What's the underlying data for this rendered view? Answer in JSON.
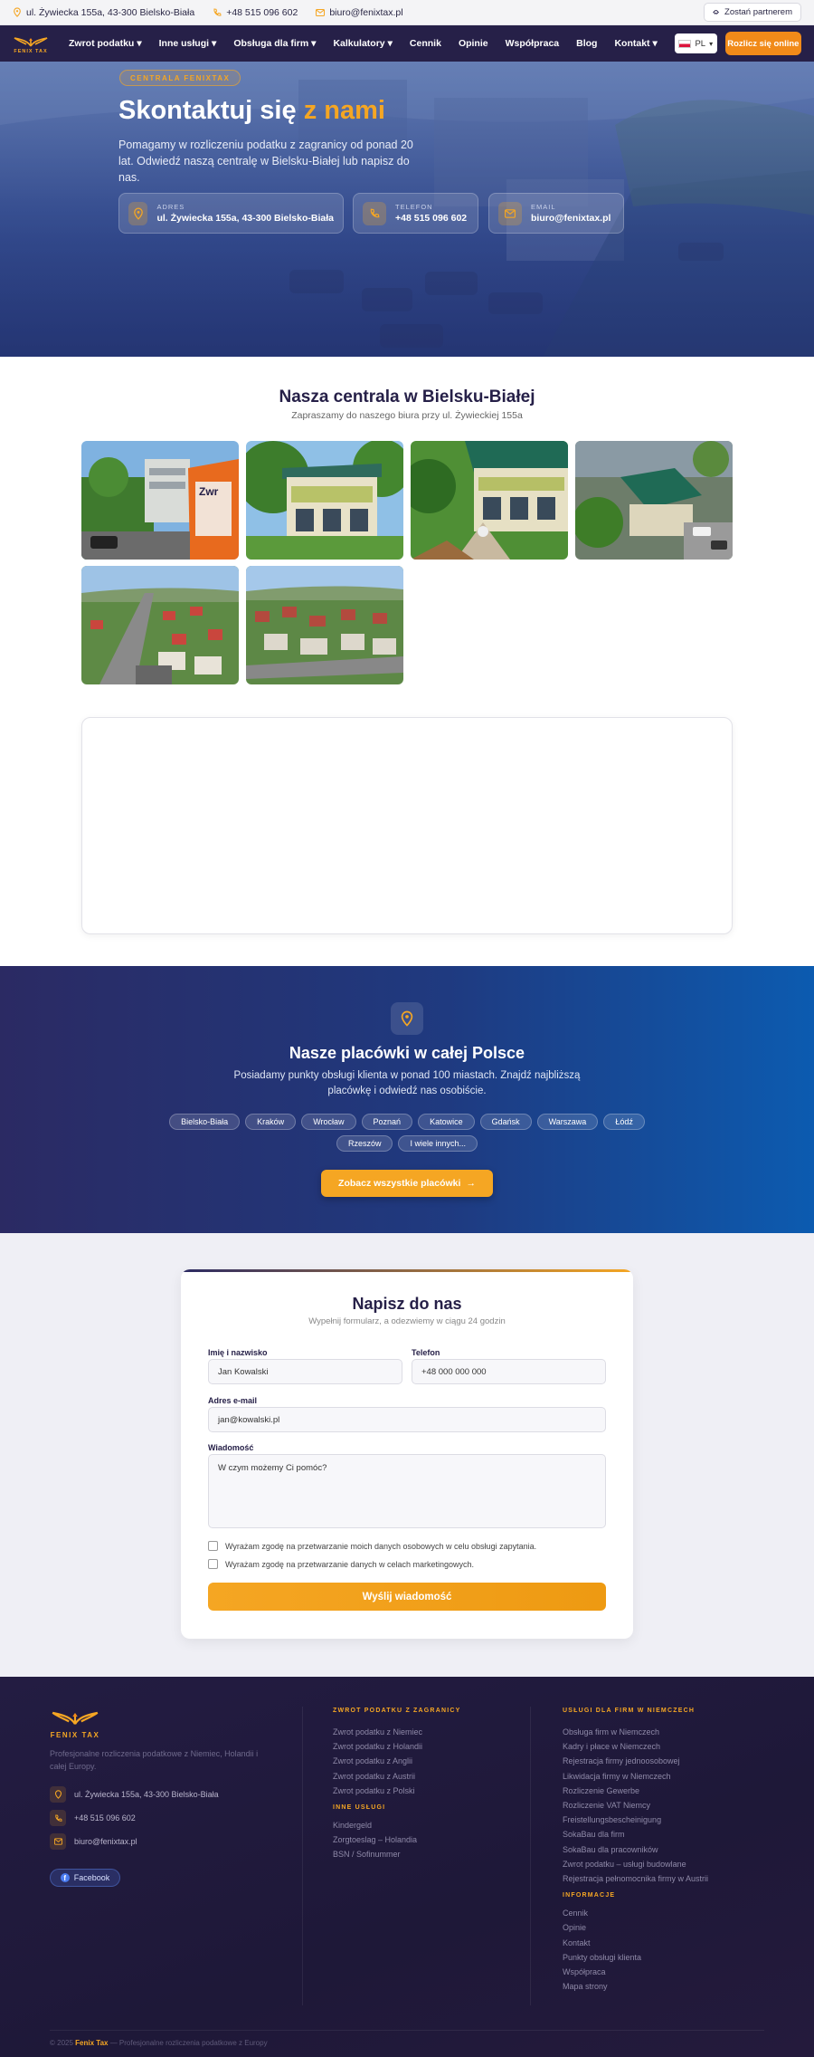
{
  "topbar": {
    "address": "ul. Żywiecka 155a, 43-300 Bielsko-Biała",
    "phone": "+48 515 096 602",
    "email": "biuro@fenixtax.pl",
    "partner": "Zostań partnerem"
  },
  "nav": {
    "logo_text": "FENIX TAX",
    "items": [
      {
        "label": "Zwrot podatku",
        "dropdown": true
      },
      {
        "label": "Inne usługi",
        "dropdown": true
      },
      {
        "label": "Obsługa dla firm",
        "dropdown": true
      },
      {
        "label": "Kalkulatory",
        "dropdown": true
      },
      {
        "label": "Cennik",
        "dropdown": false
      },
      {
        "label": "Opinie",
        "dropdown": false
      },
      {
        "label": "Współpraca",
        "dropdown": false
      },
      {
        "label": "Blog",
        "dropdown": false
      },
      {
        "label": "Kontakt",
        "dropdown": true
      }
    ],
    "lang": "PL",
    "cta": "Rozlicz się online"
  },
  "hero": {
    "badge": "CENTRALA FENIXTAX",
    "title_main": "Skontaktuj się",
    "title_highlight": "z nami",
    "subtitle": "Pomagamy w rozliczeniu podatku z zagranicy od ponad 20 lat. Odwiedź naszą centralę w Bielsku-Białej lub napisz do nas.",
    "cards": [
      {
        "label": "ADRES",
        "value": "ul. Żywiecka 155a, 43-300 Bielsko-Biała",
        "icon": "map-pin-icon"
      },
      {
        "label": "TELEFON",
        "value": "+48 515 096 602",
        "icon": "phone-icon"
      },
      {
        "label": "EMAIL",
        "value": "biuro@fenixtax.pl",
        "icon": "mail-icon"
      }
    ]
  },
  "centrala": {
    "title": "Nasza centrala w Bielsku-Białej",
    "subtitle": "Zapraszamy do naszego biura przy ul. Żywieckiej 155a",
    "photos": [
      "photo-street-sign",
      "photo-office-building",
      "photo-office-garden",
      "photo-aerial-office",
      "photo-aerial-road",
      "photo-aerial-neighborhood"
    ]
  },
  "placowki": {
    "title": "Nasze placówki w całej Polsce",
    "subtitle": "Posiadamy punkty obsługi klienta w ponad 100 miastach. Znajdź najbliższą placówkę i odwiedź nas osobiście.",
    "cities": [
      "Bielsko-Biała",
      "Kraków",
      "Wrocław",
      "Poznań",
      "Katowice",
      "Gdańsk",
      "Warszawa",
      "Łódź",
      "Rzeszów",
      "I wiele innych..."
    ],
    "button": "Zobacz wszystkie placówki"
  },
  "form": {
    "title": "Napisz do nas",
    "subtitle": "Wypełnij formularz, a odezwiemy w ciągu 24 godzin",
    "name_label": "Imię i nazwisko",
    "name_placeholder": "Jan Kowalski",
    "phone_label": "Telefon",
    "phone_placeholder": "+48 000 000 000",
    "email_label": "Adres e-mail",
    "email_placeholder": "jan@kowalski.pl",
    "message_label": "Wiadomość",
    "message_placeholder": "W czym możemy Ci pomóc?",
    "consent1": "Wyrażam zgodę na przetwarzanie moich danych osobowych w celu obsługi zapytania.",
    "consent2": "Wyrażam zgodę na przetwarzanie danych w celach marketingowych.",
    "submit": "Wyślij wiadomość"
  },
  "footer": {
    "logo_text": "FENIX TAX",
    "tagline": "Profesjonalne rozliczenia podatkowe z Niemiec, Holandii i całej Europy.",
    "address": "ul. Żywiecka 155a, 43-300 Bielsko-Biała",
    "phone": "+48 515 096 602",
    "email": "biuro@fenixtax.pl",
    "facebook": "Facebook",
    "col1_head": "ZWROT PODATKU Z ZAGRANICY",
    "col1_links": [
      "Zwrot podatku z Niemiec",
      "Zwrot podatku z Holandii",
      "Zwrot podatku z Anglii",
      "Zwrot podatku z Austrii",
      "Zwrot podatku z Polski"
    ],
    "col1b_head": "INNE USŁUGI",
    "col1b_links": [
      "Kindergeld",
      "Zorgtoeslag – Holandia",
      "BSN / Sofinummer"
    ],
    "col2_head": "USŁUGI DLA FIRM W NIEMCZECH",
    "col2_links": [
      "Obsługa firm w Niemczech",
      "Kadry i płace w Niemczech",
      "Rejestracja firmy jednoosobowej",
      "Likwidacja firmy w Niemczech",
      "Rozliczenie Gewerbe",
      "Rozliczenie VAT Niemcy",
      "Freistellungsbescheinigung",
      "SokaBau dla firm",
      "SokaBau dla pracowników",
      "Zwrot podatku – usługi budowlane",
      "Rejestracja pełnomocnika firmy w Austrii"
    ],
    "col2b_head": "INFORMACJE",
    "col2b_links": [
      "Cennik",
      "Opinie",
      "Kontakt",
      "Punkty obsługi klienta",
      "Współpraca",
      "Mapa strony"
    ],
    "copyright_prefix": "© 2025",
    "copyright_brand": "Fenix Tax",
    "copyright_suffix": "— Profesjonalne rozliczenia podatkowe z Europy"
  },
  "colors": {
    "navy": "#262048",
    "accent": "#f5a623",
    "cta": "#f18a19",
    "blue": "#0c5bb0"
  }
}
